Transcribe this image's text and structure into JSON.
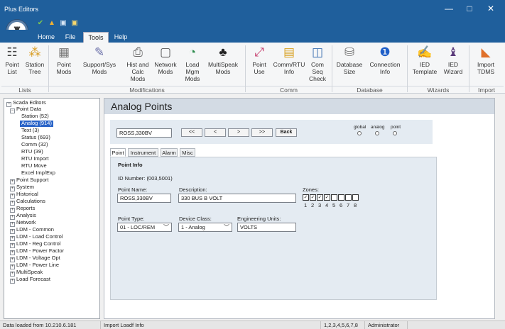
{
  "app": {
    "title": "Plus Editors"
  },
  "window_controls": {
    "minimize": "—",
    "maximize": "□",
    "close": "✕"
  },
  "menu_tabs": [
    "Home",
    "File",
    "Tools",
    "Help"
  ],
  "ribbon": {
    "buttons": [
      {
        "l1": "Point",
        "l2": "List",
        "l3": ""
      },
      {
        "l1": "Station",
        "l2": "Tree",
        "l3": ""
      },
      {
        "l1": "Point",
        "l2": "Mods",
        "l3": ""
      },
      {
        "l1": "Support/Sys",
        "l2": "Mods",
        "l3": ""
      },
      {
        "l1": "Hist and",
        "l2": "Calc",
        "l3": "Mods"
      },
      {
        "l1": "Network",
        "l2": "Mods",
        "l3": ""
      },
      {
        "l1": "Load",
        "l2": "Mgm",
        "l3": "Mods"
      },
      {
        "l1": "MultiSpeak",
        "l2": "Mods",
        "l3": ""
      },
      {
        "l1": "Point",
        "l2": "Use",
        "l3": ""
      },
      {
        "l1": "Comm/RTU",
        "l2": "Info",
        "l3": ""
      },
      {
        "l1": "Com",
        "l2": "Seq",
        "l3": "Check"
      },
      {
        "l1": "Database",
        "l2": "Size",
        "l3": ""
      },
      {
        "l1": "Connection",
        "l2": "Info",
        "l3": ""
      },
      {
        "l1": "IED",
        "l2": "Template",
        "l3": ""
      },
      {
        "l1": "IED",
        "l2": "Wizard",
        "l3": ""
      },
      {
        "l1": "Import",
        "l2": "TDMS",
        "l3": ""
      }
    ],
    "groups": [
      "Lists",
      "Modifications",
      "Comm",
      "Database",
      "Wizards",
      "Import"
    ]
  },
  "tree": {
    "items": [
      "Scada Editors",
      "Point Data",
      "Station  (52)",
      "Analog  (914)",
      "Text  (3)",
      "Status  (693)",
      "Comm  (32)",
      "RTU  (39)",
      "RTU Import",
      "RTU Move",
      "Excel Imp/Exp",
      "Point Support",
      "System",
      "Historical",
      "Calculations",
      "Reports",
      "Analysis",
      "Network",
      "LDM - Common",
      "LDM - Load Control",
      "LDM - Reg Control",
      "LDM - Power Factor",
      "LDM - Voltage Opt",
      "LDM - Power Line",
      "MultiSpeak",
      "Load Forecast"
    ]
  },
  "main": {
    "title": "Analog Points",
    "nav": {
      "point_value": "ROSS,330BV",
      "first": "<<",
      "prev": "<",
      "next": ">",
      "last": ">>",
      "back": "Back",
      "radio_labels": [
        "global",
        "analog",
        "point"
      ]
    },
    "tabs": [
      "Point",
      "Instrument",
      "Alarm",
      "Misc"
    ],
    "point_info": {
      "header": "Point Info",
      "id_label": "ID Number:",
      "id_value": "(003,5001)",
      "name_label": "Point Name:",
      "name_value": "ROSS,330BV",
      "desc_label": "Description:",
      "desc_value": "330 BUS B VOLT",
      "zones_label": "Zones:",
      "zone_numbers": [
        "1",
        "2",
        "3",
        "4",
        "5",
        "6",
        "7",
        "8"
      ],
      "zones_checked": [
        true,
        true,
        true,
        true,
        false,
        false,
        false,
        false
      ],
      "type_label": "Point Type:",
      "type_value": "01 - LOC/REM",
      "class_label": "Device Class:",
      "class_value": "1 - Analog",
      "units_label": "Engineering Units:",
      "units_value": "VOLTS"
    }
  },
  "status_bar": {
    "data_loaded": "Data loaded from 10.210.6.181",
    "import": "Import Loadf Info",
    "zones": "1,2,3,4,5,6,7,8",
    "user": "Administrator"
  },
  "colors": {
    "title_bar": "#1f5f9c",
    "selection": "#2a64c8",
    "panel": "#e4ebf2"
  }
}
